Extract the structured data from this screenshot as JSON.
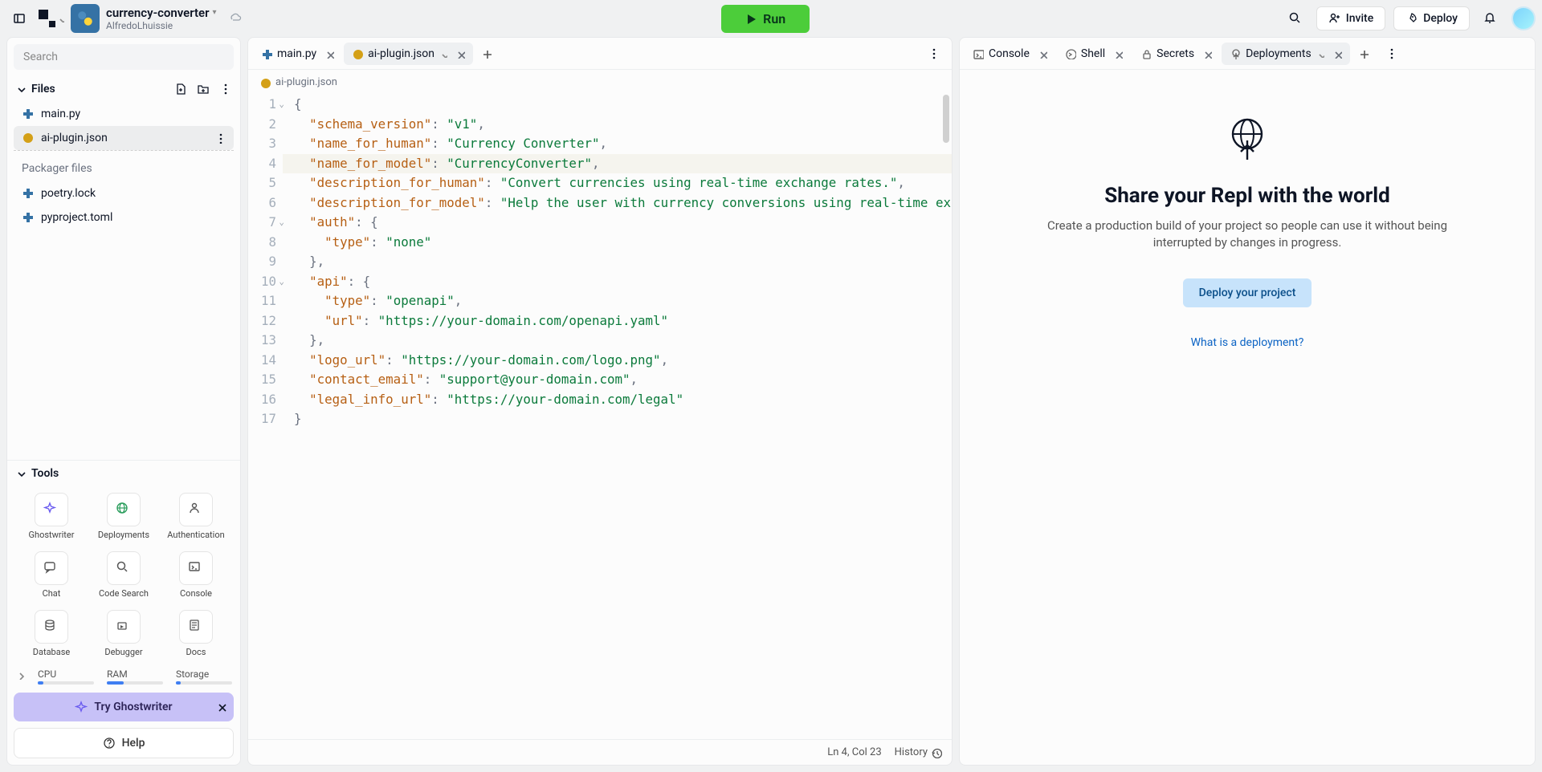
{
  "header": {
    "project_name": "currency-converter",
    "project_owner": "AlfredoLhuissie",
    "run_label": "Run",
    "invite_label": "Invite",
    "deploy_label": "Deploy"
  },
  "sidebar": {
    "search_placeholder": "Search",
    "files_label": "Files",
    "files": [
      {
        "name": "main.py",
        "icon": "python",
        "active": false
      },
      {
        "name": "ai-plugin.json",
        "icon": "json",
        "active": true
      }
    ],
    "packager_label": "Packager files",
    "packager_files": [
      {
        "name": "poetry.lock",
        "icon": "python"
      },
      {
        "name": "pyproject.toml",
        "icon": "python"
      }
    ],
    "tools_label": "Tools",
    "tools": [
      {
        "label": "Ghostwriter"
      },
      {
        "label": "Deployments"
      },
      {
        "label": "Authentication"
      },
      {
        "label": "Chat"
      },
      {
        "label": "Code Search"
      },
      {
        "label": "Console"
      },
      {
        "label": "Database"
      },
      {
        "label": "Debugger"
      },
      {
        "label": "Docs"
      }
    ],
    "resources": {
      "cpu": "CPU",
      "ram": "RAM",
      "storage": "Storage"
    },
    "ghostwriter_cta": "Try Ghostwriter",
    "help_label": "Help"
  },
  "editor": {
    "tabs": [
      {
        "label": "main.py",
        "icon": "python",
        "active": false
      },
      {
        "label": "ai-plugin.json",
        "icon": "json",
        "active": true
      }
    ],
    "breadcrumb": "ai-plugin.json",
    "status": {
      "ln_col": "Ln 4, Col 23",
      "history": "History"
    },
    "code_lines": [
      {
        "n": 1,
        "fold": true,
        "ind": 0,
        "t": [
          [
            "p",
            "{"
          ]
        ]
      },
      {
        "n": 2,
        "fold": false,
        "ind": 1,
        "t": [
          [
            "k",
            "\"schema_version\""
          ],
          [
            "p",
            ": "
          ],
          [
            "s",
            "\"v1\""
          ],
          [
            "p",
            ","
          ]
        ]
      },
      {
        "n": 3,
        "fold": false,
        "ind": 1,
        "t": [
          [
            "k",
            "\"name_for_human\""
          ],
          [
            "p",
            ": "
          ],
          [
            "s",
            "\"Currency Converter\""
          ],
          [
            "p",
            ","
          ]
        ]
      },
      {
        "n": 4,
        "fold": false,
        "ind": 1,
        "hl": true,
        "t": [
          [
            "k",
            "\"name_for_model\""
          ],
          [
            "p",
            ": "
          ],
          [
            "s",
            "\"CurrencyConverter\""
          ],
          [
            "p",
            ","
          ]
        ]
      },
      {
        "n": 5,
        "fold": false,
        "ind": 1,
        "t": [
          [
            "k",
            "\"description_for_human\""
          ],
          [
            "p",
            ": "
          ],
          [
            "s",
            "\"Convert currencies using real-time exchange rates.\""
          ],
          [
            "p",
            ","
          ]
        ]
      },
      {
        "n": 6,
        "fold": false,
        "ind": 1,
        "t": [
          [
            "k",
            "\"description_for_model\""
          ],
          [
            "p",
            ": "
          ],
          [
            "s",
            "\"Help the user with currency conversions using real-time exchange rates.\""
          ],
          [
            "p",
            ","
          ]
        ]
      },
      {
        "n": 7,
        "fold": true,
        "ind": 1,
        "t": [
          [
            "k",
            "\"auth\""
          ],
          [
            "p",
            ": {"
          ]
        ]
      },
      {
        "n": 8,
        "fold": false,
        "ind": 2,
        "t": [
          [
            "k",
            "\"type\""
          ],
          [
            "p",
            ": "
          ],
          [
            "s",
            "\"none\""
          ]
        ]
      },
      {
        "n": 9,
        "fold": false,
        "ind": 1,
        "t": [
          [
            "p",
            "},"
          ]
        ]
      },
      {
        "n": 10,
        "fold": true,
        "ind": 1,
        "t": [
          [
            "k",
            "\"api\""
          ],
          [
            "p",
            ": {"
          ]
        ]
      },
      {
        "n": 11,
        "fold": false,
        "ind": 2,
        "t": [
          [
            "k",
            "\"type\""
          ],
          [
            "p",
            ": "
          ],
          [
            "s",
            "\"openapi\""
          ],
          [
            "p",
            ","
          ]
        ]
      },
      {
        "n": 12,
        "fold": false,
        "ind": 2,
        "t": [
          [
            "k",
            "\"url\""
          ],
          [
            "p",
            ": "
          ],
          [
            "s",
            "\"https://your-domain.com/openapi.yaml\""
          ]
        ]
      },
      {
        "n": 13,
        "fold": false,
        "ind": 1,
        "t": [
          [
            "p",
            "},"
          ]
        ]
      },
      {
        "n": 14,
        "fold": false,
        "ind": 1,
        "t": [
          [
            "k",
            "\"logo_url\""
          ],
          [
            "p",
            ": "
          ],
          [
            "s",
            "\"https://your-domain.com/logo.png\""
          ],
          [
            "p",
            ","
          ]
        ]
      },
      {
        "n": 15,
        "fold": false,
        "ind": 1,
        "t": [
          [
            "k",
            "\"contact_email\""
          ],
          [
            "p",
            ": "
          ],
          [
            "s",
            "\"support@your-domain.com\""
          ],
          [
            "p",
            ","
          ]
        ]
      },
      {
        "n": 16,
        "fold": false,
        "ind": 1,
        "t": [
          [
            "k",
            "\"legal_info_url\""
          ],
          [
            "p",
            ": "
          ],
          [
            "s",
            "\"https://your-domain.com/legal\""
          ]
        ]
      },
      {
        "n": 17,
        "fold": false,
        "ind": 0,
        "t": [
          [
            "p",
            "}"
          ]
        ]
      }
    ]
  },
  "right": {
    "tabs": [
      {
        "label": "Console",
        "icon": "console"
      },
      {
        "label": "Shell",
        "icon": "shell"
      },
      {
        "label": "Secrets",
        "icon": "lock"
      },
      {
        "label": "Deployments",
        "icon": "deploy",
        "active": true
      }
    ],
    "heading": "Share your Repl with the world",
    "subtext": "Create a production build of your project so people can use it without being interrupted by changes in progress.",
    "deploy_button": "Deploy your project",
    "info_link": "What is a deployment?"
  }
}
